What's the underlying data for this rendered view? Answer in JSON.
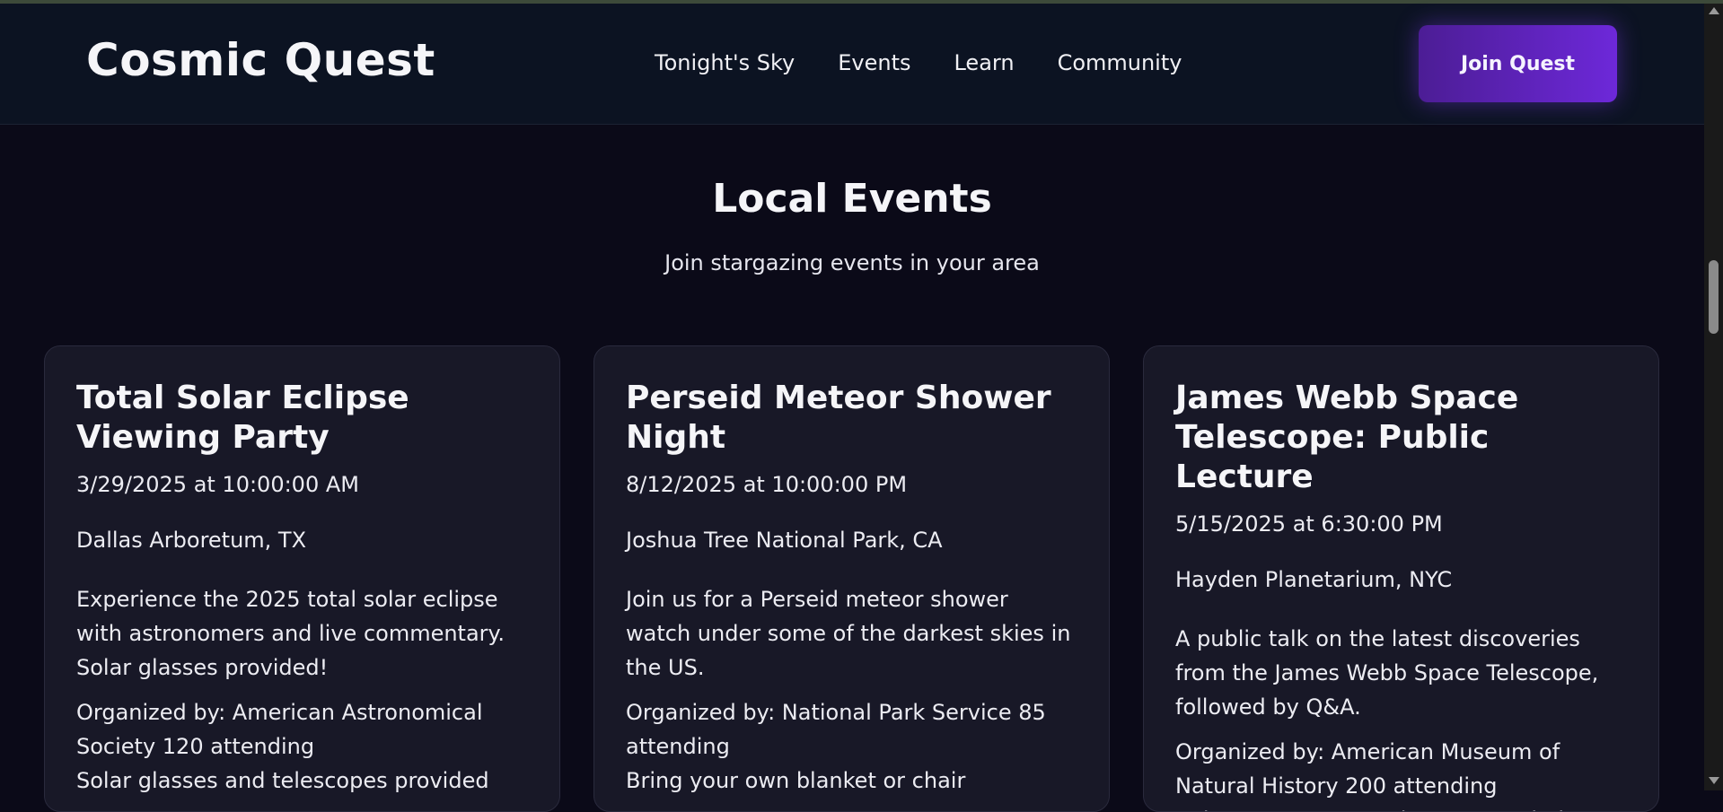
{
  "header": {
    "logo": "Cosmic Quest",
    "nav": [
      "Tonight's Sky",
      "Events",
      "Learn",
      "Community"
    ],
    "cta": "Join Quest"
  },
  "section": {
    "title": "Local Events",
    "subtitle": "Join stargazing events in your area"
  },
  "events": [
    {
      "title": "Total Solar Eclipse Viewing Party",
      "datetime": "3/29/2025 at 10:00:00 AM",
      "location": "Dallas Arboretum, TX",
      "description": "Experience the 2025 total solar eclipse with astronomers and live commentary. Solar glasses provided!",
      "organizer": "Organized by: American Astronomical Society 120 attending",
      "note": "Solar glasses and telescopes provided"
    },
    {
      "title": "Perseid Meteor Shower Night",
      "datetime": "8/12/2025 at 10:00:00 PM",
      "location": "Joshua Tree National Park, CA",
      "description": "Join us for a Perseid meteor shower watch under some of the darkest skies in the US.",
      "organizer": "Organized by: National Park Service 85 attending",
      "note": "Bring your own blanket or chair"
    },
    {
      "title": "James Webb Space Telescope: Public Lecture",
      "datetime": "5/15/2025 at 6:30:00 PM",
      "location": "Hayden Planetarium, NYC",
      "description": "A public talk on the latest discoveries from the James Webb Space Telescope, followed by Q&A.",
      "organizer": "Organized by: American Museum of Natural History 200 attending",
      "note": "Indoor event, no equipment needed"
    }
  ],
  "colors": {
    "background": "#0b0a18",
    "header": "#0c1322",
    "card": "#181827",
    "accent_start": "#4c1d95",
    "accent_end": "#6d28d9"
  },
  "icons": [
    "scroll-up-arrow-icon",
    "scroll-down-arrow-icon"
  ]
}
